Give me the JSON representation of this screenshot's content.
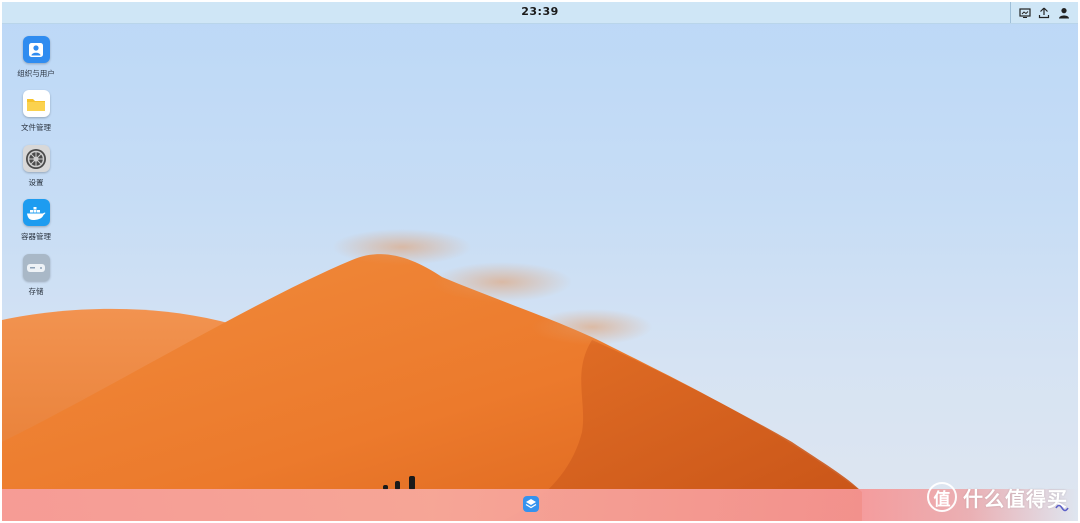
{
  "topbar": {
    "clock": "23:39",
    "tray": [
      {
        "name": "display-icon"
      },
      {
        "name": "upload-icon"
      },
      {
        "name": "user-icon"
      }
    ]
  },
  "desktop": {
    "icons": [
      {
        "label": "组织与用户",
        "icon": "user-card-icon",
        "color": "#2f8cf0"
      },
      {
        "label": "文件管理",
        "icon": "folder-icon",
        "color": "#f7c32b"
      },
      {
        "label": "设置",
        "icon": "settings-icon",
        "color": "#5a5a5a"
      },
      {
        "label": "容器管理",
        "icon": "docker-icon",
        "color": "#1d9cf0"
      },
      {
        "label": "存储",
        "icon": "storage-icon",
        "color": "#8ea3b8"
      }
    ]
  },
  "dock": {
    "launcher_icon": "app-launcher-icon"
  },
  "watermark": {
    "circle_char": "值",
    "text": "什么值得买"
  }
}
